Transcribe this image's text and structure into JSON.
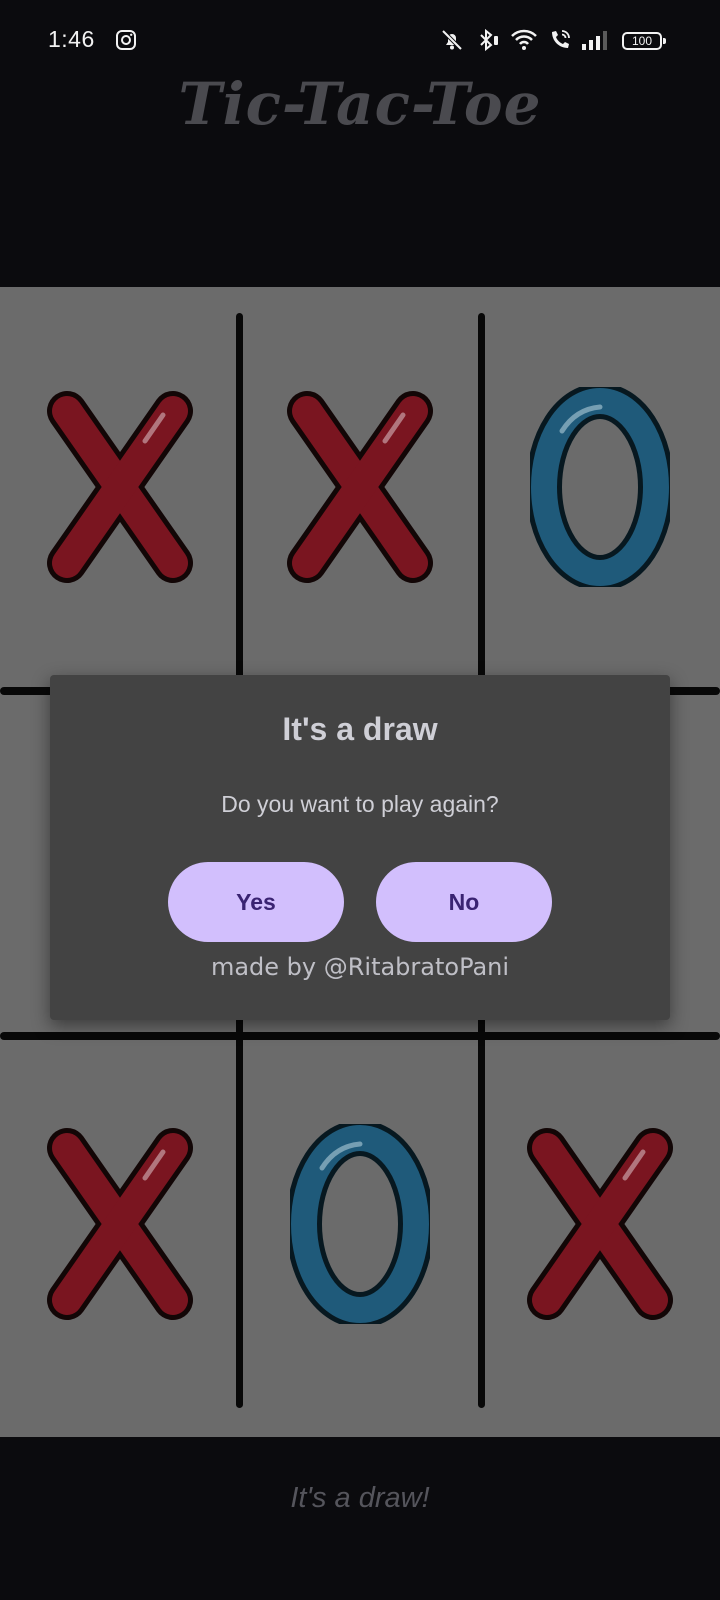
{
  "status_bar": {
    "time": "1:46",
    "battery": "100",
    "icons": [
      "instagram-icon",
      "mute-icon",
      "bluetooth-icon",
      "wifi-icon",
      "wifi-calling-icon",
      "signal-icon",
      "battery-icon"
    ]
  },
  "app": {
    "title": "Tic-Tac-Toe"
  },
  "board": {
    "cells": [
      "X",
      "X",
      "O",
      "",
      "",
      "",
      "X",
      "O",
      "X"
    ],
    "colors": {
      "x": "#7a1520",
      "o": "#1f5a7a",
      "background": "#6b6b6b"
    }
  },
  "dialog": {
    "title": "It's a draw",
    "message": "Do you want to play again?",
    "yes_label": "Yes",
    "no_label": "No",
    "credit": "made by @RitabratoPani"
  },
  "footer": {
    "status": "It's a draw!"
  },
  "colors": {
    "button_bg": "#d2bffd",
    "button_text": "#3a2372",
    "dialog_bg": "#434343"
  }
}
